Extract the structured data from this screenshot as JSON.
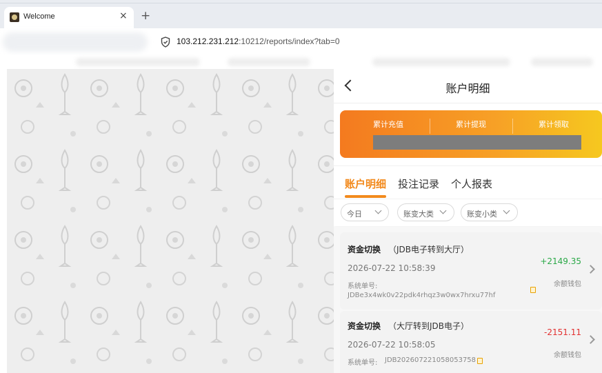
{
  "browser": {
    "tab_title": "Welcome",
    "tab_close": "×",
    "new_tab": "+",
    "url_host": "103.212.231.212",
    "url_rest": ":10212/reports/index?tab=0"
  },
  "panel": {
    "title": "账户明细",
    "summary": {
      "items": [
        "累计充值",
        "累计提现",
        "累计领取"
      ]
    },
    "tabs": [
      "账户明细",
      "投注记录",
      "个人报表"
    ],
    "filters": [
      "今日",
      "账变大类",
      "账变小类"
    ],
    "records": [
      {
        "type": "资金切换",
        "detail": "（JDB电子转到大厅）",
        "time": "2026-07-22 10:58:39",
        "order_label": "系统单号:",
        "order_no": "JDBe3x4wk0v22pdk4rhqz3w0wx7hrxu77hf",
        "amount": "+2149.35",
        "wallet": "余额钱包"
      },
      {
        "type": "资金切换",
        "detail": "（大厅转到JDB电子）",
        "time": "2026-07-22 10:58:05",
        "order_label": "系统单号:",
        "order_no": "JDB202607221058053758",
        "amount": "-2151.11",
        "wallet": "余额钱包"
      }
    ]
  },
  "colors": {
    "accent": "#f28a1d",
    "positive": "#2aa847",
    "negative": "#e23030"
  }
}
